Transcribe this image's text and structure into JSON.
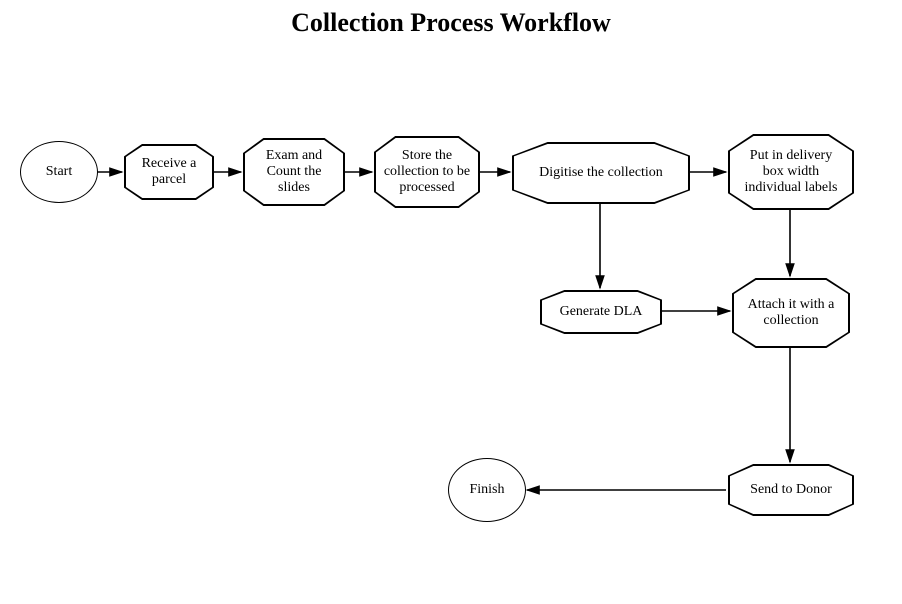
{
  "title": "Collection Process Workflow",
  "nodes": {
    "start": "Start",
    "receive": "Receive a parcel",
    "exam": "Exam and Count the slides",
    "store": "Store the collection to be processed",
    "digitise": "Digitise the collection",
    "putbox": "Put in delivery box width individual labels",
    "gendla": "Generate DLA",
    "attach": "Attach it with a collection",
    "send": "Send to Donor",
    "finish": "Finish"
  },
  "edges": [
    {
      "from": "start",
      "to": "receive"
    },
    {
      "from": "receive",
      "to": "exam"
    },
    {
      "from": "exam",
      "to": "store"
    },
    {
      "from": "store",
      "to": "digitise"
    },
    {
      "from": "digitise",
      "to": "putbox"
    },
    {
      "from": "digitise",
      "to": "gendla"
    },
    {
      "from": "putbox",
      "to": "attach"
    },
    {
      "from": "gendla",
      "to": "attach"
    },
    {
      "from": "attach",
      "to": "send"
    },
    {
      "from": "send",
      "to": "finish"
    }
  ]
}
